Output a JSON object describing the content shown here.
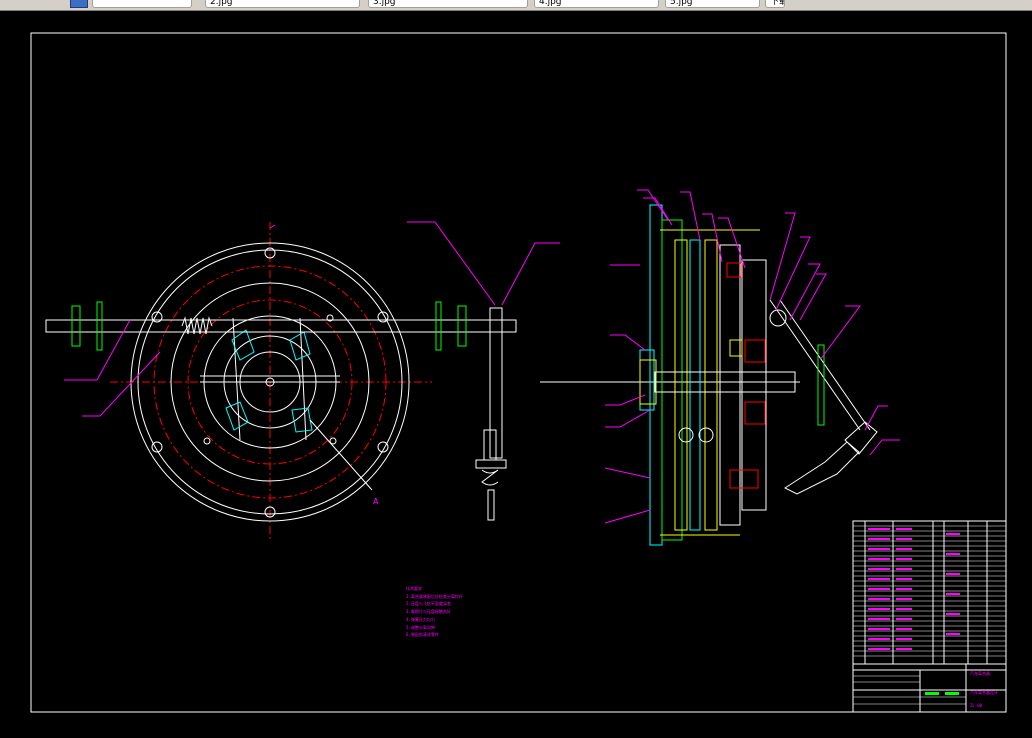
{
  "tabs": [
    {
      "label": "",
      "name": "tab-1"
    },
    {
      "label": "2.jpg",
      "name": "tab-2"
    },
    {
      "label": "3.jpg",
      "name": "tab-3"
    },
    {
      "label": "4.jpg",
      "name": "tab-4"
    },
    {
      "label": "5.jpg",
      "name": "tab-5"
    },
    {
      "label": "下载",
      "name": "tab-6"
    }
  ],
  "drawing": {
    "section_label": "A",
    "colors": {
      "background": "#000000",
      "outline": "#ffffff",
      "centerline": "#ff0000",
      "leader": "#ff00ff",
      "hatch": "#00ffff",
      "part": "#ffff00",
      "accent": "#00ff00"
    }
  },
  "technical_requirements": {
    "title": "技术要求",
    "items": [
      "1.离合器装配后应检查分离杠杆",
      "2.压盘与飞轮平面度误差",
      "3.摩擦片与压盘接触良好",
      "4.弹簧压力均匀",
      "5.调整分离间隙",
      "6.装配前清洗零件"
    ]
  },
  "title_block": {
    "drawing_name": "汽车离合器",
    "unit": "汽车离合器设计",
    "code": "ZL-00"
  }
}
